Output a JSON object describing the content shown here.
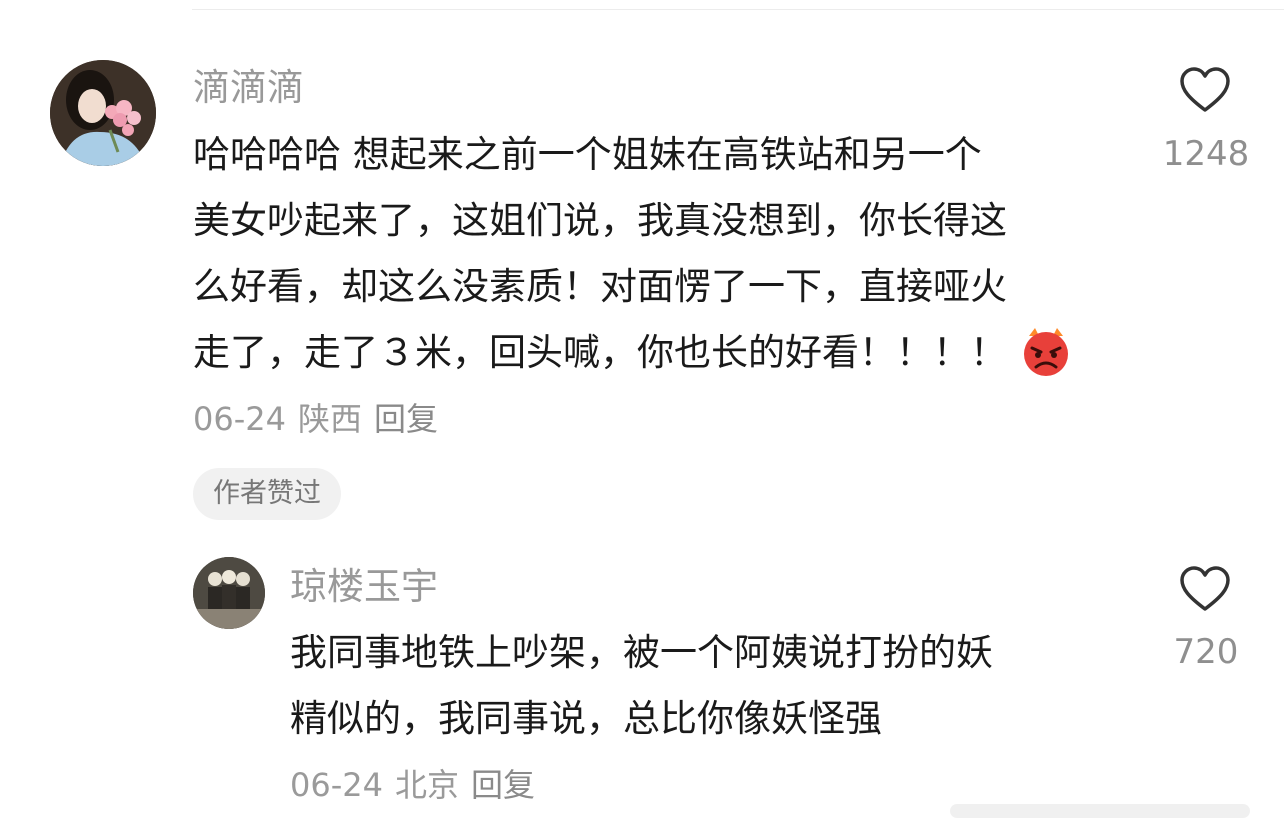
{
  "comment": {
    "username": "滴滴滴",
    "text_lines": [
      "哈哈哈哈  想起来之前一个姐妹在高铁站和另一个",
      "美女吵起来了，这姐们说，我真没想到，你长得这",
      "么好看，却这么没素质！对面愣了一下，直接哑火",
      "走了，走了３米，回头喊，你也长的好看！！！！"
    ],
    "emoji": "angry-face-emoji",
    "date": "06-24",
    "location": "陕西",
    "reply_label": "回复",
    "author_liked_badge": "作者赞过",
    "like_count": "1248"
  },
  "reply": {
    "username": "琼楼玉宇",
    "text_lines": [
      "我同事地铁上吵架，被一个阿姨说打扮的妖",
      "精似的，我同事说，总比你像妖怪强"
    ],
    "date": "06-24",
    "location": "北京",
    "reply_label": "回复",
    "like_count": "720"
  },
  "icons": {
    "like": "heart-outline-icon",
    "emoji": "angry-face-emoji"
  },
  "colors": {
    "username": "#999999",
    "text": "#1a1a1a",
    "meta": "#9a9a9a",
    "badge_bg": "#f1f1f1",
    "icon_stroke": "#333333",
    "emoji_red": "#e8403a"
  }
}
